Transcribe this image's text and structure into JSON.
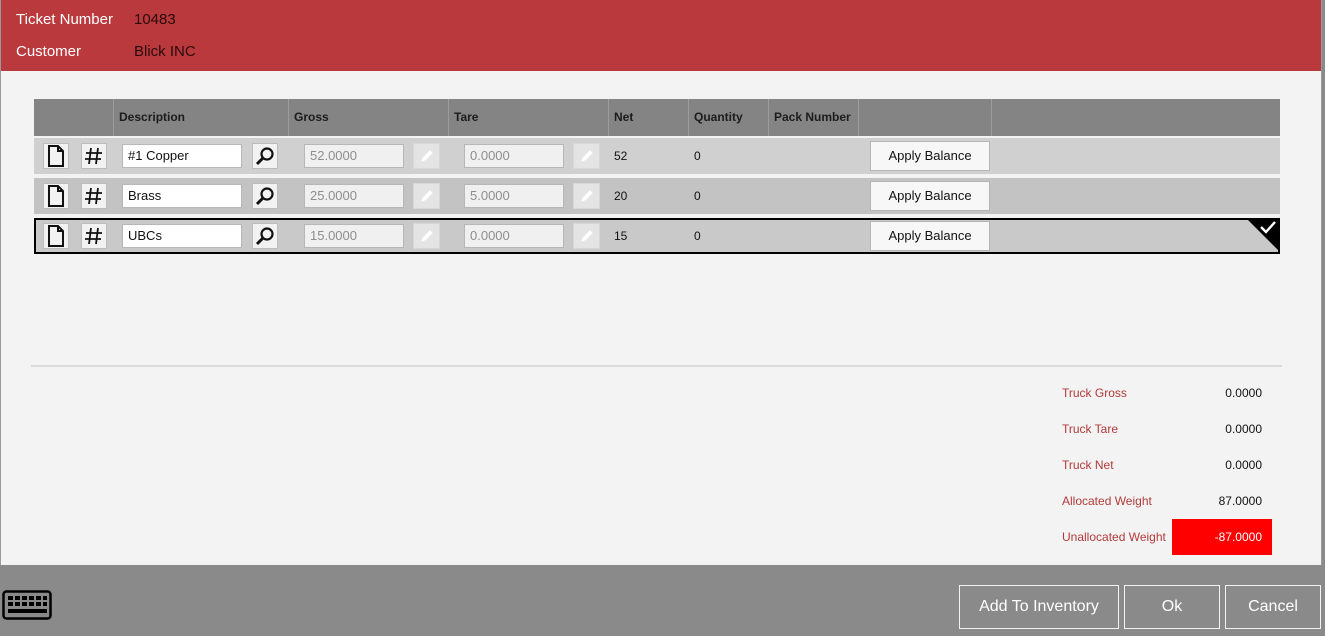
{
  "header": {
    "ticket_label": "Ticket Number",
    "ticket_value": "10483",
    "customer_label": "Customer",
    "customer_value": "Blick INC"
  },
  "grid": {
    "columns": [
      "Description",
      "Gross",
      "Tare",
      "Net",
      "Quantity",
      "Pack Number"
    ],
    "apply_label": "Apply Balance",
    "rows": [
      {
        "description": "#1 Copper",
        "gross": "52.0000",
        "tare": "0.0000",
        "net": "52",
        "quantity": "0",
        "pack_number": ""
      },
      {
        "description": "Brass",
        "gross": "25.0000",
        "tare": "5.0000",
        "net": "20",
        "quantity": "0",
        "pack_number": ""
      },
      {
        "description": "UBCs",
        "gross": "15.0000",
        "tare": "0.0000",
        "net": "15",
        "quantity": "0",
        "pack_number": ""
      }
    ],
    "selected_row": 2
  },
  "summary": {
    "truck_gross_label": "Truck Gross",
    "truck_gross": "0.0000",
    "truck_tare_label": "Truck Tare",
    "truck_tare": "0.0000",
    "truck_net_label": "Truck Net",
    "truck_net": "0.0000",
    "allocated_label": "Allocated Weight",
    "allocated": "87.0000",
    "unallocated_label": "Unallocated Weight",
    "unallocated": "-87.0000"
  },
  "footer": {
    "add_inventory": "Add To Inventory",
    "ok": "Ok",
    "cancel": "Cancel"
  },
  "colors": {
    "header": "#b9393c",
    "summary_label": "#b23a3a",
    "warning": "#ff0000"
  },
  "icons": {
    "new_row": "document-icon",
    "number": "hash-icon",
    "search": "magnifier-icon",
    "edit": "pencil-icon",
    "selected": "checkmark-icon",
    "keyboard": "keyboard-icon"
  }
}
